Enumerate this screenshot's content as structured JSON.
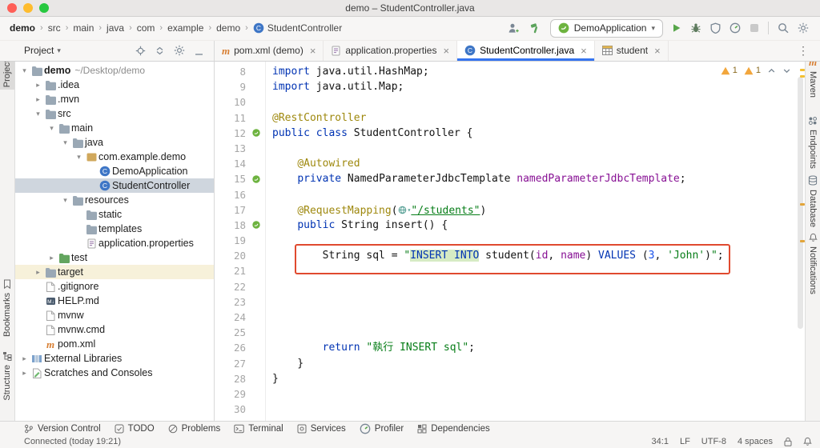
{
  "colors": {
    "tab_accent": "#3574f0",
    "annotation_box": "#e04a2f",
    "selection_bg": "#cfd6de",
    "excluded_bg": "#f7f1da",
    "keyword": "#0033b3",
    "string": "#067d17",
    "annotation": "#9e880d",
    "field": "#871094"
  },
  "window": {
    "title": "demo – StudentController.java"
  },
  "toolbar": {
    "breadcrumbs": [
      {
        "label": "demo",
        "bold": true
      },
      {
        "label": "src"
      },
      {
        "label": "main"
      },
      {
        "label": "java"
      },
      {
        "label": "com"
      },
      {
        "label": "example"
      },
      {
        "label": "demo"
      },
      {
        "label": "StudentController",
        "icon": "class"
      }
    ],
    "run_config": {
      "label": "DemoApplication"
    }
  },
  "project_panel": {
    "title": "Project",
    "tree": [
      {
        "label": "demo",
        "hint": "~/Desktop/demo",
        "indent": 0,
        "icon": "folder",
        "chevron": "open",
        "bold": true
      },
      {
        "label": ".idea",
        "indent": 1,
        "icon": "folder",
        "chevron": "closed"
      },
      {
        "label": ".mvn",
        "indent": 1,
        "icon": "folder",
        "chevron": "closed"
      },
      {
        "label": "src",
        "indent": 1,
        "icon": "folder",
        "chevron": "open"
      },
      {
        "label": "main",
        "indent": 2,
        "icon": "folder",
        "chevron": "open"
      },
      {
        "label": "java",
        "indent": 3,
        "icon": "folder",
        "chevron": "open"
      },
      {
        "label": "com.example.demo",
        "indent": 4,
        "icon": "package",
        "chevron": "open"
      },
      {
        "label": "DemoApplication",
        "indent": 5,
        "icon": "class"
      },
      {
        "label": "StudentController",
        "indent": 5,
        "icon": "class",
        "selected": true
      },
      {
        "label": "resources",
        "indent": 3,
        "icon": "folder",
        "chevron": "open"
      },
      {
        "label": "static",
        "indent": 4,
        "icon": "folder"
      },
      {
        "label": "templates",
        "indent": 4,
        "icon": "folder"
      },
      {
        "label": "application.properties",
        "indent": 4,
        "icon": "properties"
      },
      {
        "label": "test",
        "indent": 2,
        "icon": "folder-test",
        "chevron": "closed"
      },
      {
        "label": "target",
        "indent": 1,
        "icon": "folder",
        "chevron": "closed",
        "excluded": true
      },
      {
        "label": ".gitignore",
        "indent": 1,
        "icon": "file"
      },
      {
        "label": "HELP.md",
        "indent": 1,
        "icon": "md"
      },
      {
        "label": "mvnw",
        "indent": 1,
        "icon": "file"
      },
      {
        "label": "mvnw.cmd",
        "indent": 1,
        "icon": "file"
      },
      {
        "label": "pom.xml",
        "indent": 1,
        "icon": "maven"
      },
      {
        "label": "External Libraries",
        "indent": 0,
        "icon": "libs",
        "chevron": "closed"
      },
      {
        "label": "Scratches and Consoles",
        "indent": 0,
        "icon": "scratch",
        "chevron": "closed"
      }
    ]
  },
  "editor_tabs": [
    {
      "label": "pom.xml (demo)",
      "icon": "maven"
    },
    {
      "label": "application.properties",
      "icon": "properties"
    },
    {
      "label": "StudentController.java",
      "icon": "class",
      "active": true
    },
    {
      "label": "student",
      "icon": "table"
    }
  ],
  "editor": {
    "badges": [
      "1",
      "1"
    ],
    "lines": [
      {
        "n": 8,
        "t": [
          [
            "kw",
            "import"
          ],
          [
            "pl",
            " java.util.HashMap;"
          ]
        ]
      },
      {
        "n": 9,
        "t": [
          [
            "kw",
            "import"
          ],
          [
            "pl",
            " java.util.Map;"
          ]
        ]
      },
      {
        "n": 10,
        "t": []
      },
      {
        "n": 11,
        "t": [
          [
            "ann",
            "@RestController"
          ]
        ]
      },
      {
        "n": 12,
        "g": true,
        "t": [
          [
            "kw",
            "public class"
          ],
          [
            "pl",
            " StudentController {"
          ]
        ]
      },
      {
        "n": 13,
        "t": []
      },
      {
        "n": 14,
        "t": [
          [
            "pl",
            "    "
          ],
          [
            "ann",
            "@Autowired"
          ]
        ]
      },
      {
        "n": 15,
        "g": true,
        "t": [
          [
            "pl",
            "    "
          ],
          [
            "kw",
            "private"
          ],
          [
            "pl",
            " NamedParameterJdbcTemplate "
          ],
          [
            "field",
            "namedParameterJdbcTemplate"
          ],
          [
            "pl",
            ";"
          ]
        ]
      },
      {
        "n": 16,
        "t": []
      },
      {
        "n": 17,
        "t": [
          [
            "pl",
            "    "
          ],
          [
            "ann",
            "@RequestMapping"
          ],
          [
            "pl",
            "("
          ],
          [
            "globe",
            ""
          ],
          [
            "stru",
            "\"/students\""
          ],
          [
            "pl",
            ")"
          ]
        ]
      },
      {
        "n": 18,
        "g": true,
        "t": [
          [
            "pl",
            "    "
          ],
          [
            "kw",
            "public"
          ],
          [
            "pl",
            " String insert() {"
          ]
        ]
      },
      {
        "n": 19,
        "t": []
      },
      {
        "n": 20,
        "t": [
          [
            "pl",
            "        String "
          ],
          [
            "pl",
            "sql"
          ],
          [
            "pl",
            " = "
          ],
          [
            "str",
            "\""
          ],
          [
            "sqlkw",
            "INSERT INTO"
          ],
          [
            "pl",
            " student("
          ],
          [
            "field",
            "id"
          ],
          [
            "pl",
            ", "
          ],
          [
            "field",
            "name"
          ],
          [
            "pl",
            ") "
          ],
          [
            "kw",
            "VALUES"
          ],
          [
            "pl",
            " ("
          ],
          [
            "num",
            "3"
          ],
          [
            "pl",
            ", "
          ],
          [
            "str",
            "'John'"
          ],
          [
            "pl",
            ")"
          ],
          [
            "str",
            "\""
          ],
          [
            "pl",
            ";"
          ]
        ]
      },
      {
        "n": 21,
        "t": []
      },
      {
        "n": 22,
        "t": []
      },
      {
        "n": 23,
        "t": []
      },
      {
        "n": 24,
        "t": []
      },
      {
        "n": 25,
        "t": []
      },
      {
        "n": 26,
        "t": [
          [
            "pl",
            "        "
          ],
          [
            "kw",
            "return"
          ],
          [
            "pl",
            " "
          ],
          [
            "str",
            "\"執行 INSERT sql\""
          ],
          [
            "pl",
            ";"
          ]
        ]
      },
      {
        "n": 27,
        "t": [
          [
            "pl",
            "    }"
          ]
        ]
      },
      {
        "n": 28,
        "t": [
          [
            "pl",
            "}"
          ]
        ]
      },
      {
        "n": 29,
        "t": []
      },
      {
        "n": 30,
        "t": []
      }
    ]
  },
  "stripes": {
    "left": [
      {
        "label": "Project",
        "icon": "project",
        "active": true
      },
      {
        "label": "Bookmarks",
        "icon": "bookmarks"
      },
      {
        "label": "Structure",
        "icon": "structure"
      }
    ],
    "right": [
      {
        "label": "Maven",
        "icon": "maven"
      },
      {
        "label": "Endpoints",
        "icon": "endpoints"
      },
      {
        "label": "Database",
        "icon": "database"
      },
      {
        "label": "Notifications",
        "icon": "bell"
      }
    ]
  },
  "bottom_tools": [
    {
      "label": "Version Control",
      "icon": "branch"
    },
    {
      "label": "TODO",
      "icon": "todo"
    },
    {
      "label": "Problems",
      "icon": "problems"
    },
    {
      "label": "Terminal",
      "icon": "terminal"
    },
    {
      "label": "Services",
      "icon": "services"
    },
    {
      "label": "Profiler",
      "icon": "gauge"
    },
    {
      "label": "Dependencies",
      "icon": "dependencies"
    }
  ],
  "status_bar": {
    "message": "Connected (today 19:21)",
    "caret": "34:1",
    "line_ending": "LF",
    "encoding": "UTF-8",
    "indent": "4 spaces"
  }
}
